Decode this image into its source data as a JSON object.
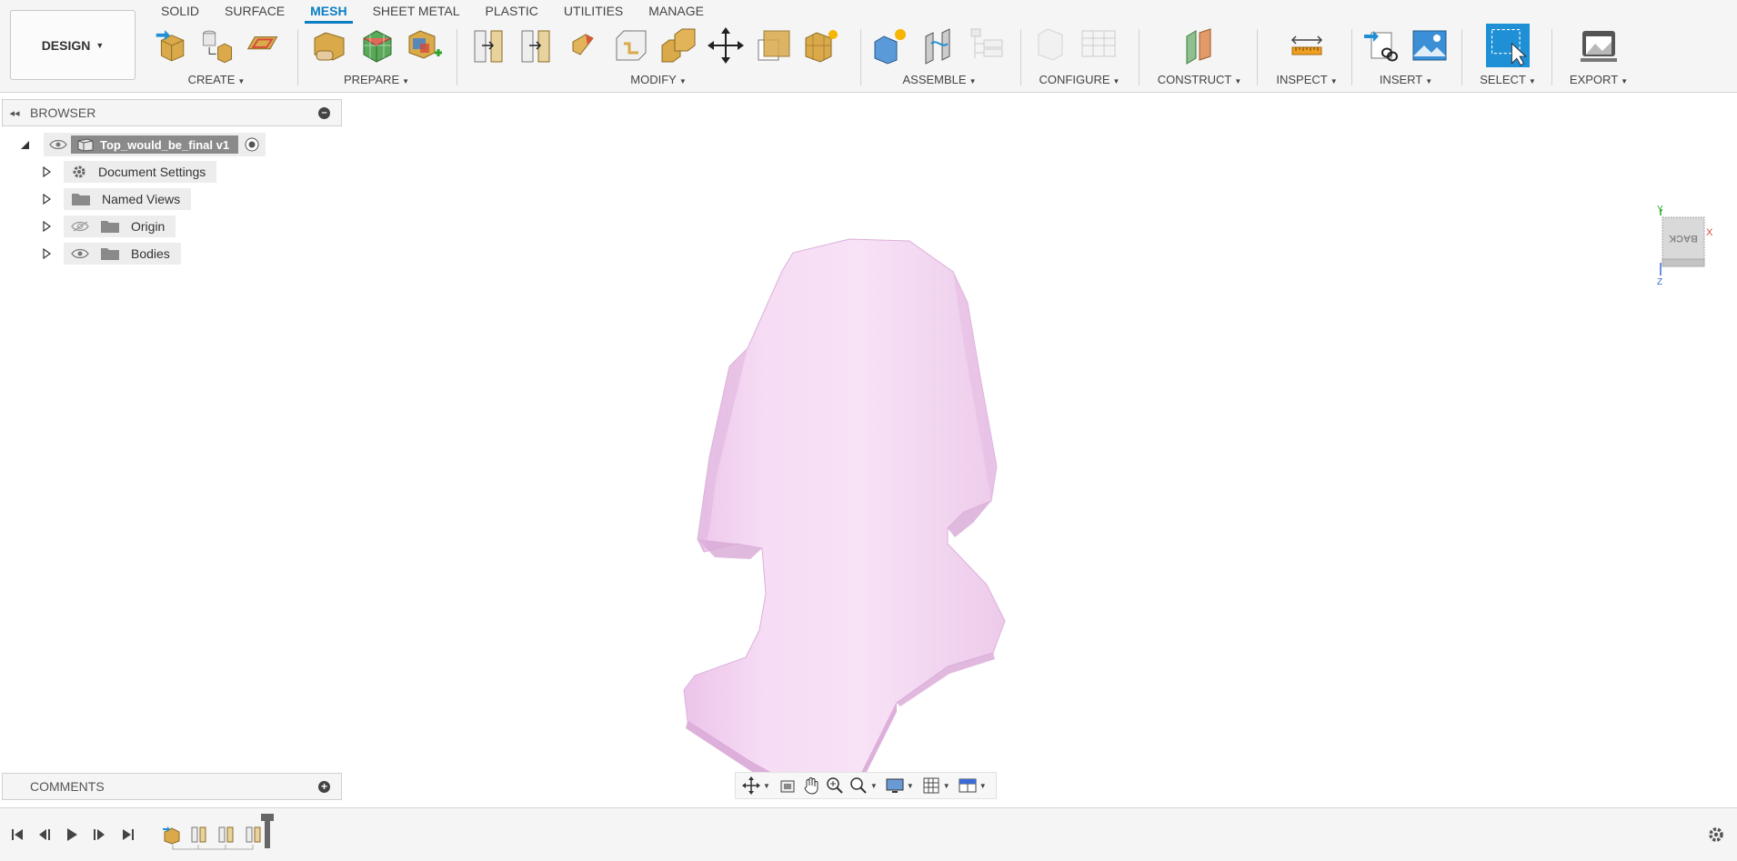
{
  "workspace": {
    "label": "DESIGN"
  },
  "tabs": [
    {
      "label": "SOLID",
      "active": false
    },
    {
      "label": "SURFACE",
      "active": false
    },
    {
      "label": "MESH",
      "active": true
    },
    {
      "label": "SHEET METAL",
      "active": false
    },
    {
      "label": "PLASTIC",
      "active": false
    },
    {
      "label": "UTILITIES",
      "active": false
    },
    {
      "label": "MANAGE",
      "active": false
    }
  ],
  "groups": {
    "create": "CREATE",
    "prepare": "PREPARE",
    "modify": "MODIFY",
    "assemble": "ASSEMBLE",
    "configure": "CONFIGURE",
    "construct": "CONSTRUCT",
    "inspect": "INSPECT",
    "insert": "INSERT",
    "select": "SELECT",
    "export": "EXPORT"
  },
  "browser": {
    "title": "BROWSER",
    "root": {
      "name": "Top_would_be_final v1"
    },
    "items": [
      {
        "label": "Document Settings",
        "icon": "gear-icon"
      },
      {
        "label": "Named Views",
        "icon": "folder-icon"
      },
      {
        "label": "Origin",
        "icon": "folder-icon",
        "visibility": "hidden"
      },
      {
        "label": "Bodies",
        "icon": "folder-icon",
        "visibility": "visible"
      }
    ]
  },
  "viewcube": {
    "face": "BACK",
    "axes": {
      "x": "X",
      "y": "Y",
      "z": "Z"
    }
  },
  "comments": {
    "title": "COMMENTS"
  },
  "colors": {
    "accent": "#0a7ec2",
    "model_fill": "#f4d4f2",
    "model_shade": "#e2b9e0"
  }
}
